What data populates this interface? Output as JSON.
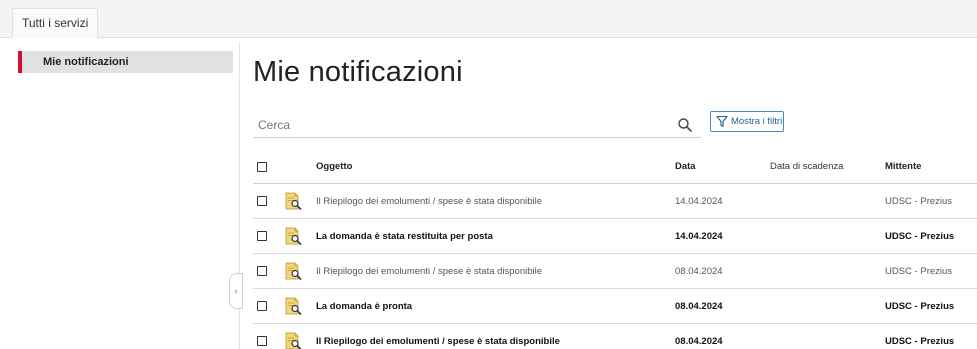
{
  "topbar": {
    "tab_label": "Tutti i servizi"
  },
  "sidebar": {
    "items": [
      {
        "label": "Mie notificazioni"
      }
    ]
  },
  "collapse_glyph": "‹",
  "main": {
    "title": "Mie notificazioni",
    "search": {
      "placeholder": "Cerca",
      "value": ""
    },
    "filter_button": "Mostra i filtri"
  },
  "table": {
    "columns": {
      "subject": "Oggetto",
      "date": "Data",
      "due": "Data di scadenza",
      "sender": "Mittente"
    },
    "rows": [
      {
        "subject": "Il Riepilogo dei emolumenti / spese è stata disponibile",
        "date": "14.04.2024",
        "due": "",
        "sender": "UDSC - Prezius",
        "unread": false
      },
      {
        "subject": "La domanda è stata restituita per posta",
        "date": "14.04.2024",
        "due": "",
        "sender": "UDSC - Prezius",
        "unread": true
      },
      {
        "subject": "Il Riepilogo dei emolumenti / spese è stata disponibile",
        "date": "08.04.2024",
        "due": "",
        "sender": "UDSC - Prezius",
        "unread": false
      },
      {
        "subject": "La domanda è pronta",
        "date": "08.04.2024",
        "due": "",
        "sender": "UDSC - Prezius",
        "unread": true
      },
      {
        "subject": "Il Riepilogo dei emolumenti / spese è stata disponibile",
        "date": "08.04.2024",
        "due": "",
        "sender": "UDSC - Prezius",
        "unread": true
      }
    ]
  },
  "colors": {
    "accent_red": "#d40f2b",
    "link_blue": "#1f5f9e",
    "icon_yellow": "#e8c15a"
  },
  "icons": {
    "row_icon": "document-magnifier-icon",
    "search": "search-icon",
    "filter": "funnel-icon"
  }
}
